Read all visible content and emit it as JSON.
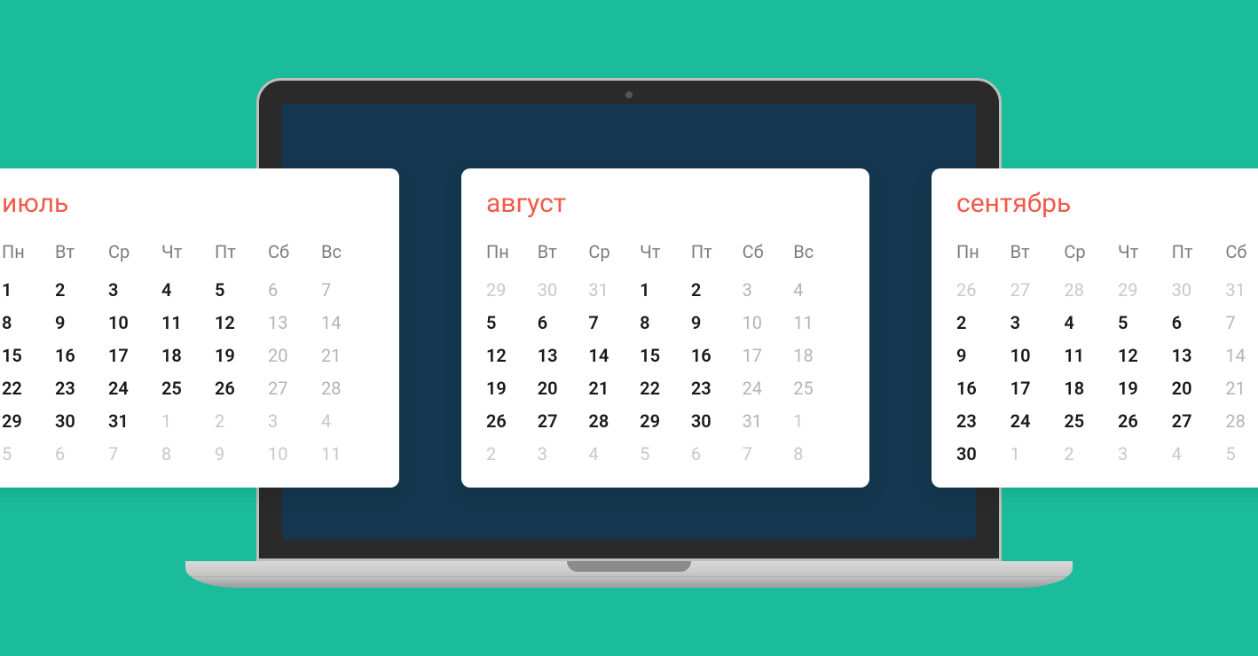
{
  "dow": [
    "Пн",
    "Вт",
    "Ср",
    "Чт",
    "Пт",
    "Сб",
    "Вс"
  ],
  "months": [
    {
      "name": "июль",
      "cols": 7,
      "edge": "left",
      "weeks": [
        [
          {
            "d": "1"
          },
          {
            "d": "2"
          },
          {
            "d": "3"
          },
          {
            "d": "4"
          },
          {
            "d": "5"
          },
          {
            "d": "6",
            "w": true
          },
          {
            "d": "7",
            "w": true
          }
        ],
        [
          {
            "d": "8"
          },
          {
            "d": "9"
          },
          {
            "d": "10"
          },
          {
            "d": "11"
          },
          {
            "d": "12"
          },
          {
            "d": "13",
            "w": true
          },
          {
            "d": "14",
            "w": true
          }
        ],
        [
          {
            "d": "15"
          },
          {
            "d": "16"
          },
          {
            "d": "17"
          },
          {
            "d": "18"
          },
          {
            "d": "19"
          },
          {
            "d": "20",
            "w": true
          },
          {
            "d": "21",
            "w": true
          }
        ],
        [
          {
            "d": "22"
          },
          {
            "d": "23"
          },
          {
            "d": "24"
          },
          {
            "d": "25"
          },
          {
            "d": "26"
          },
          {
            "d": "27",
            "w": true
          },
          {
            "d": "28",
            "w": true
          }
        ],
        [
          {
            "d": "29"
          },
          {
            "d": "30"
          },
          {
            "d": "31"
          },
          {
            "d": "1",
            "o": true
          },
          {
            "d": "2",
            "o": true
          },
          {
            "d": "3",
            "o": true
          },
          {
            "d": "4",
            "o": true
          }
        ],
        [
          {
            "d": "5",
            "o": true
          },
          {
            "d": "6",
            "o": true
          },
          {
            "d": "7",
            "o": true
          },
          {
            "d": "8",
            "o": true
          },
          {
            "d": "9",
            "o": true
          },
          {
            "d": "10",
            "o": true
          },
          {
            "d": "11",
            "o": true
          }
        ]
      ]
    },
    {
      "name": "август",
      "cols": 7,
      "edge": "none",
      "weeks": [
        [
          {
            "d": "29",
            "o": true
          },
          {
            "d": "30",
            "o": true
          },
          {
            "d": "31",
            "o": true
          },
          {
            "d": "1"
          },
          {
            "d": "2"
          },
          {
            "d": "3",
            "w": true
          },
          {
            "d": "4",
            "w": true
          }
        ],
        [
          {
            "d": "5"
          },
          {
            "d": "6"
          },
          {
            "d": "7"
          },
          {
            "d": "8"
          },
          {
            "d": "9"
          },
          {
            "d": "10",
            "w": true
          },
          {
            "d": "11",
            "w": true
          }
        ],
        [
          {
            "d": "12"
          },
          {
            "d": "13"
          },
          {
            "d": "14"
          },
          {
            "d": "15"
          },
          {
            "d": "16"
          },
          {
            "d": "17",
            "w": true
          },
          {
            "d": "18",
            "w": true
          }
        ],
        [
          {
            "d": "19"
          },
          {
            "d": "20"
          },
          {
            "d": "21"
          },
          {
            "d": "22"
          },
          {
            "d": "23"
          },
          {
            "d": "24",
            "w": true
          },
          {
            "d": "25",
            "w": true
          }
        ],
        [
          {
            "d": "26"
          },
          {
            "d": "27"
          },
          {
            "d": "28"
          },
          {
            "d": "29"
          },
          {
            "d": "30"
          },
          {
            "d": "31",
            "w": true
          },
          {
            "d": "1",
            "o": true
          }
        ],
        [
          {
            "d": "2",
            "o": true
          },
          {
            "d": "3",
            "o": true
          },
          {
            "d": "4",
            "o": true
          },
          {
            "d": "5",
            "o": true
          },
          {
            "d": "6",
            "o": true
          },
          {
            "d": "7",
            "o": true
          },
          {
            "d": "8",
            "o": true
          }
        ]
      ]
    },
    {
      "name": "сентябрь",
      "cols": 6,
      "edge": "right",
      "weeks": [
        [
          {
            "d": "26",
            "o": true
          },
          {
            "d": "27",
            "o": true
          },
          {
            "d": "28",
            "o": true
          },
          {
            "d": "29",
            "o": true
          },
          {
            "d": "30",
            "o": true
          },
          {
            "d": "31",
            "o": true
          }
        ],
        [
          {
            "d": "2"
          },
          {
            "d": "3"
          },
          {
            "d": "4"
          },
          {
            "d": "5"
          },
          {
            "d": "6"
          },
          {
            "d": "7",
            "w": true
          }
        ],
        [
          {
            "d": "9"
          },
          {
            "d": "10"
          },
          {
            "d": "11"
          },
          {
            "d": "12"
          },
          {
            "d": "13"
          },
          {
            "d": "14",
            "w": true
          }
        ],
        [
          {
            "d": "16"
          },
          {
            "d": "17"
          },
          {
            "d": "18"
          },
          {
            "d": "19"
          },
          {
            "d": "20"
          },
          {
            "d": "21",
            "w": true
          }
        ],
        [
          {
            "d": "23"
          },
          {
            "d": "24"
          },
          {
            "d": "25"
          },
          {
            "d": "26"
          },
          {
            "d": "27"
          },
          {
            "d": "28",
            "w": true
          }
        ],
        [
          {
            "d": "30"
          },
          {
            "d": "1",
            "o": true
          },
          {
            "d": "2",
            "o": true
          },
          {
            "d": "3",
            "o": true
          },
          {
            "d": "4",
            "o": true
          },
          {
            "d": "5",
            "o": true
          }
        ]
      ]
    }
  ]
}
